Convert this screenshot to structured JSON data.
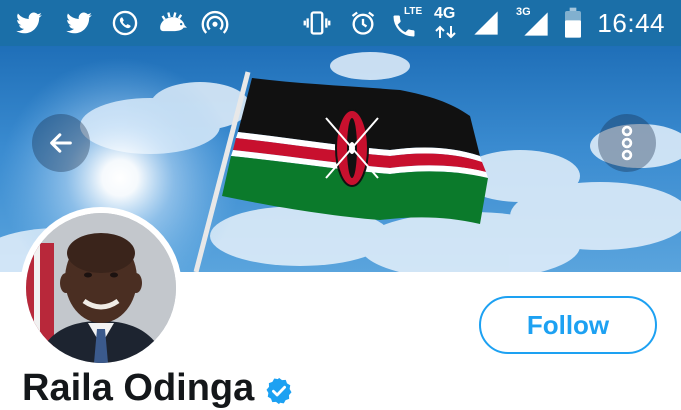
{
  "status_bar": {
    "time": "16:44",
    "network_lte": "LTE",
    "network_4g": "4G",
    "network_3g": "3G",
    "icons": [
      "twitter-icon",
      "twitter-icon",
      "whatsapp-icon",
      "hedgehog-icon",
      "hotspot-icon",
      "vibrate-icon",
      "alarm-icon",
      "volte-call-icon",
      "signal-icon",
      "signal-icon",
      "battery-icon"
    ]
  },
  "header": {
    "back_icon": "arrow-left-icon",
    "more_icon": "more-vertical-icon"
  },
  "profile": {
    "name": "Raila Odinga",
    "follow_label": "Follow",
    "verified_icon": "verified-badge-icon"
  },
  "colors": {
    "status_bar": "#1b6fa8",
    "accent": "#1da1f2",
    "flag_black": "#111111",
    "flag_red": "#c8102e",
    "flag_green": "#0b7a2b"
  }
}
